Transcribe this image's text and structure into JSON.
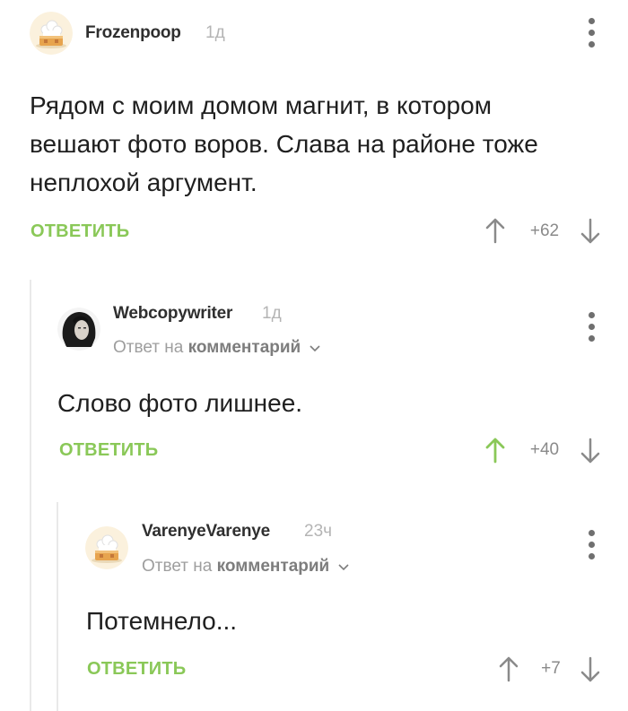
{
  "comments": [
    {
      "author": "Frozenpoop",
      "time": "1д",
      "text_lines": [
        "Рядом с моим домом магнит, в котором",
        "вешают фото воров. Слава на районе тоже",
        "неплохой аргумент."
      ],
      "reply_label": "ОТВЕТИТЬ",
      "rating": "+62",
      "avatar": "cake-avatar"
    },
    {
      "author": "Webcopywriter",
      "time": "1д",
      "reply_prefix": "Ответ на",
      "reply_target": "комментарий",
      "text_lines": [
        "Слово фото лишнее."
      ],
      "reply_label": "ОТВЕТИТЬ",
      "rating": "+40",
      "upvoted": true,
      "avatar": "portrait-avatar"
    },
    {
      "author": "VarenyeVarenye",
      "time": "23ч",
      "reply_prefix": "Ответ на",
      "reply_target": "комментарий",
      "text_lines": [
        "Потемнело..."
      ],
      "reply_label": "ОТВЕТИТЬ",
      "rating": "+7",
      "avatar": "cake-avatar"
    }
  ],
  "colors": {
    "accent_green": "#8ac858",
    "arrow_gray": "#8a8a8a",
    "thread_line": "#e9e9e9"
  }
}
